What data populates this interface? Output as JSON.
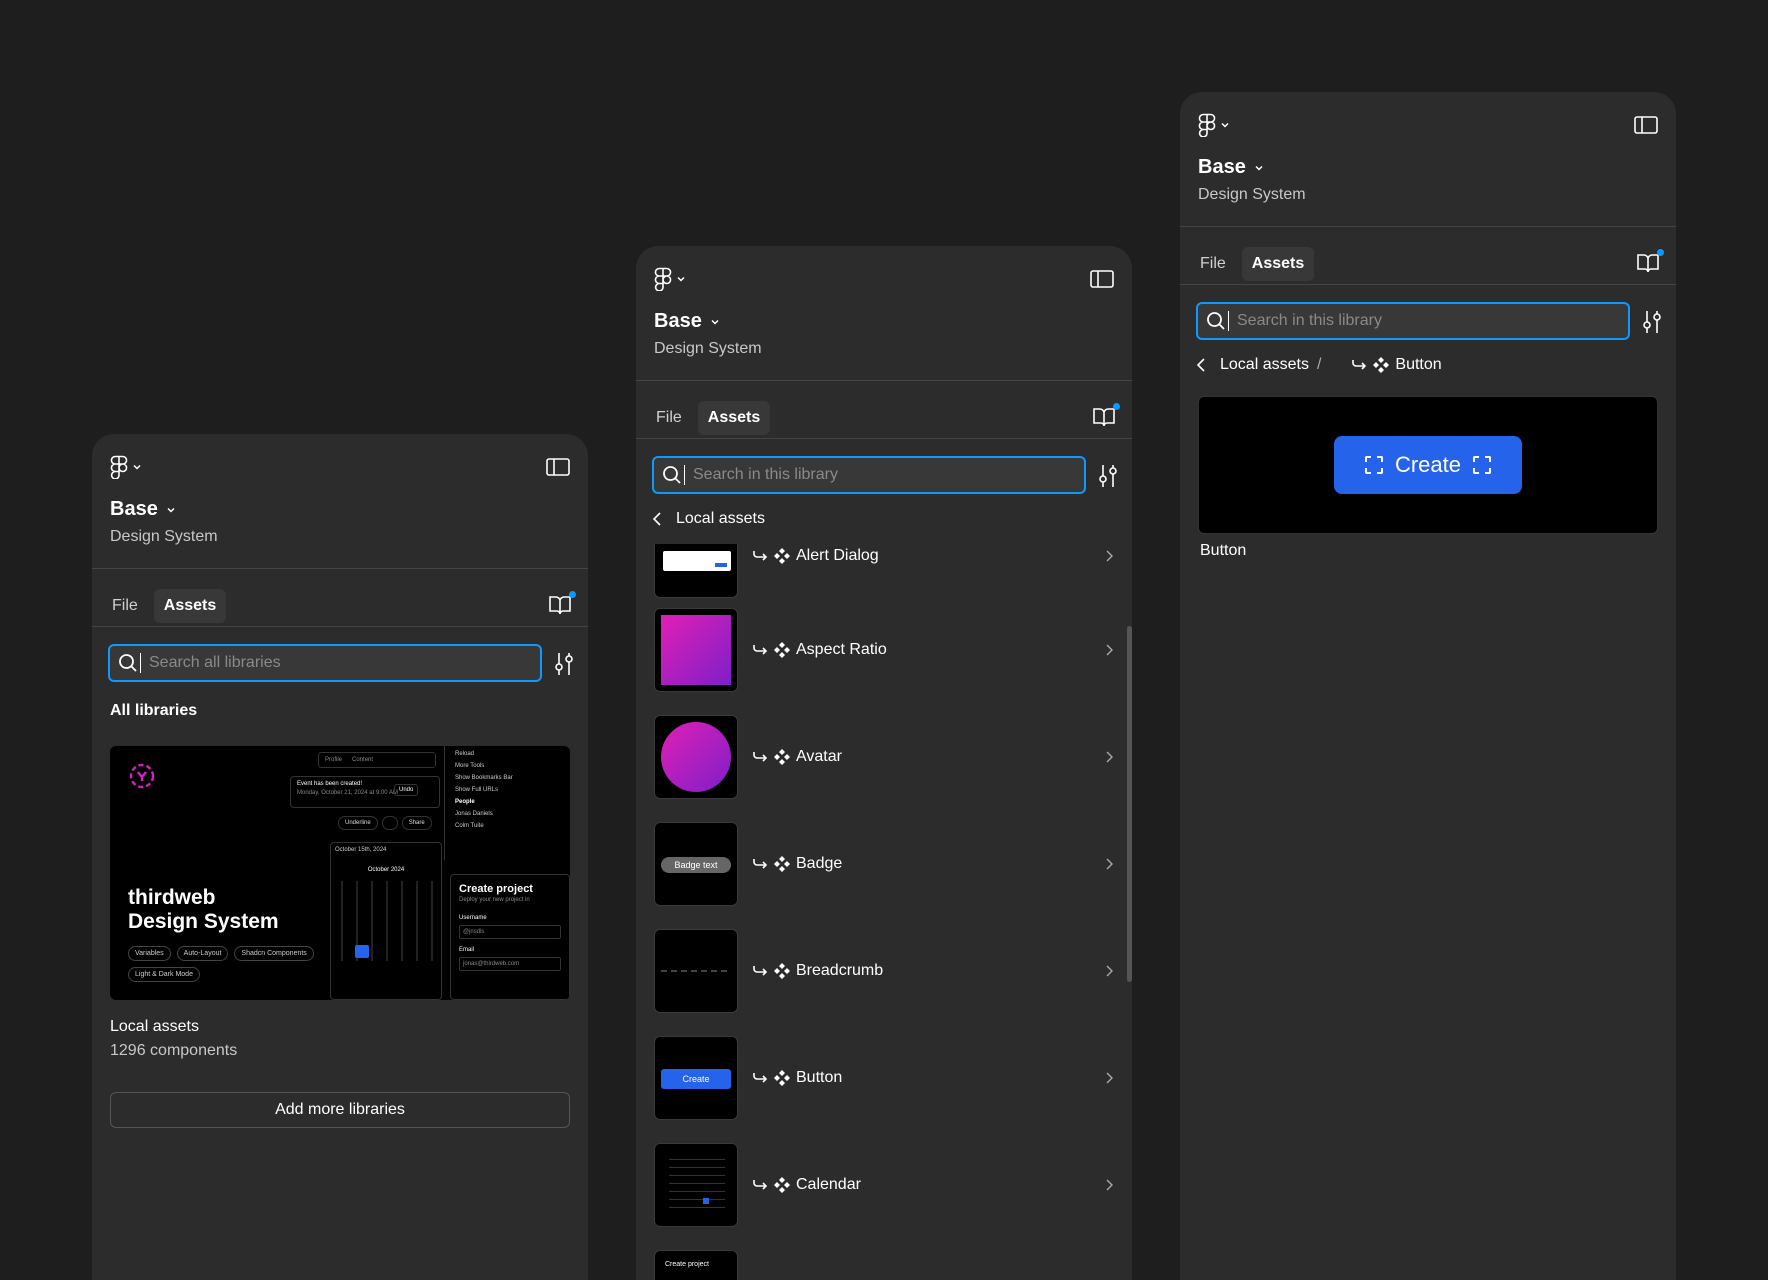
{
  "colors": {
    "background": "#1e1e1e",
    "panel": "#2c2c2c",
    "accent": "#0d99ff",
    "button": "#2563eb"
  },
  "panel1": {
    "title": "Base",
    "subtitle": "Design System",
    "tabs": {
      "file": "File",
      "assets": "Assets"
    },
    "search_placeholder": "Search all libraries",
    "section": "All libraries",
    "library": {
      "preview_title_line1": "thirdweb",
      "preview_title_line2": "Design System",
      "preview_chips": [
        "Variables",
        "Auto-Layout",
        "Shadcn Components",
        "Light & Dark Mode"
      ],
      "preview_toast_title": "Event has been created!",
      "preview_toast_sub": "Monday, October 21, 2024 at 9:00 AM",
      "preview_undo": "Undo",
      "preview_tab1": "Profile",
      "preview_tab2": "Content",
      "preview_underline": "Underline",
      "preview_share": "Share",
      "preview_date": "October 15th, 2024",
      "preview_month": "October 2024",
      "preview_menu": [
        "Reload",
        "More Tools",
        "Show Bookmarks Bar",
        "Show Full URLs",
        "People",
        "Jonas Daniels",
        "Colm Tuite"
      ],
      "preview_create": "Create project",
      "preview_create_sub": "Deploy your new project in",
      "preview_username_label": "Username",
      "preview_username": "@jnsdls",
      "preview_email_label": "Email",
      "preview_email": "jonas@thirdweb.com",
      "name": "Local assets",
      "count": "1296 components"
    },
    "add_button": "Add more libraries"
  },
  "panel2": {
    "title": "Base",
    "subtitle": "Design System",
    "tabs": {
      "file": "File",
      "assets": "Assets"
    },
    "search_placeholder": "Search in this library",
    "breadcrumb": "Local assets",
    "items": [
      {
        "label": "Alert Dialog"
      },
      {
        "label": "Aspect Ratio"
      },
      {
        "label": "Avatar"
      },
      {
        "label": "Badge",
        "thumb_text": "Badge text"
      },
      {
        "label": "Breadcrumb"
      },
      {
        "label": "Button",
        "thumb_text": "Create"
      },
      {
        "label": "Calendar"
      },
      {
        "label": "",
        "thumb_text": "Create project"
      }
    ]
  },
  "panel3": {
    "title": "Base",
    "subtitle": "Design System",
    "tabs": {
      "file": "File",
      "assets": "Assets"
    },
    "search_placeholder": "Search in this library",
    "breadcrumb_root": "Local assets",
    "breadcrumb_sep": "/",
    "breadcrumb_current": "Button",
    "preview_button": "Create",
    "component_name": "Button"
  }
}
